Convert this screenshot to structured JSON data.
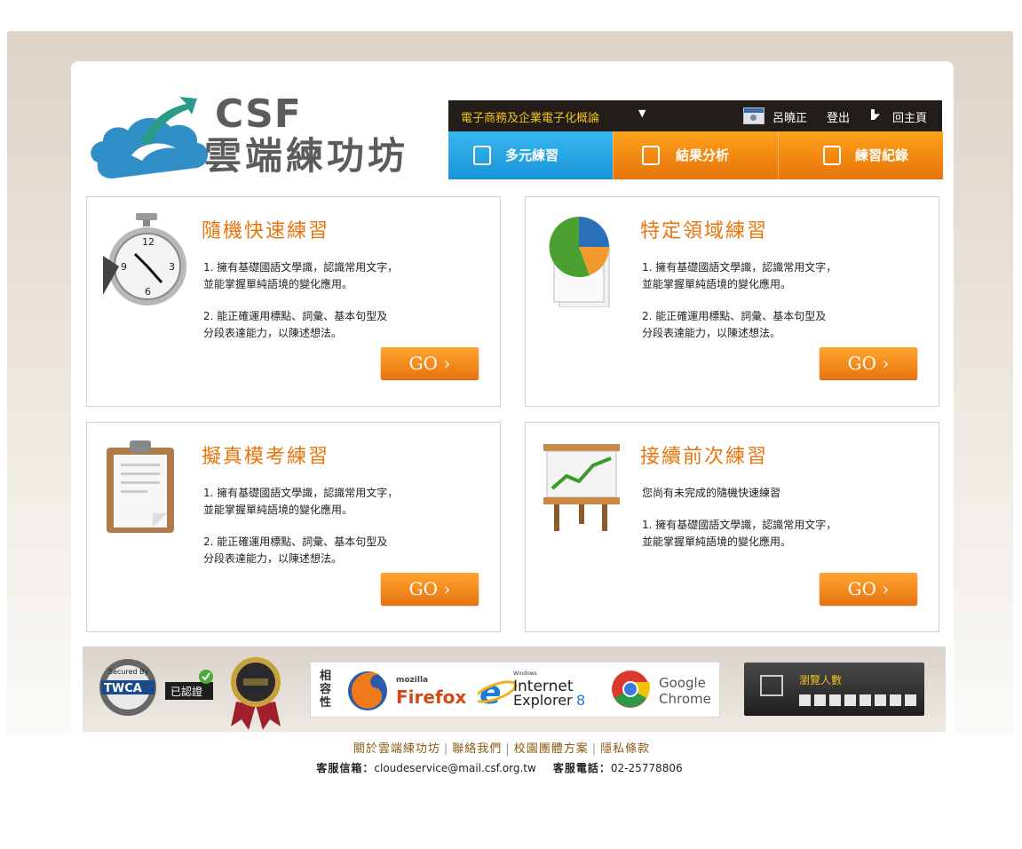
{
  "logo": {
    "brand": "CSF",
    "name": "雲端練功坊"
  },
  "topbar": {
    "course": "電子商務及企業電子化概論",
    "user": "呂曉正",
    "logout": "登出",
    "home": "回主頁"
  },
  "nav": [
    {
      "label": "多元練習",
      "icon": "calendar-clock-icon"
    },
    {
      "label": "結果分析",
      "icon": "document-icon"
    },
    {
      "label": "練習紀錄",
      "icon": "pencil-note-icon"
    }
  ],
  "panels": [
    {
      "title": "隨機快速練習",
      "desc1": "1. 擁有基礎國語文學識，認識常用文字，\n並能掌握單純語境的變化應用。",
      "desc2": "2. 能正確運用標點、詞彙、基本句型及\n分段表達能力，以陳述想法。",
      "go": "GO ›",
      "icon": "stopwatch-icon"
    },
    {
      "title": "特定領域練習",
      "desc1": "1. 擁有基礎國語文學識，認識常用文字，\n並能掌握單純語境的變化應用。",
      "desc2": "2. 能正確運用標點、詞彙、基本句型及\n分段表達能力，以陳述想法。",
      "go": "GO ›",
      "icon": "pie-chart-document-icon"
    },
    {
      "title": "擬真模考練習",
      "desc1": "1. 擁有基礎國語文學識，認識常用文字，\n並能掌握單純語境的變化應用。",
      "desc2": "2. 能正確運用標點、詞彙、基本句型及\n分段表達能力，以陳述想法。",
      "go": "GO ›",
      "icon": "clipboard-icon"
    },
    {
      "title": "接續前次練習",
      "desc1": "您尚有未完成的隨機快速練習",
      "desc2": "1. 擁有基礎國語文學識，認識常用文字，\n並能掌握單純語境的變化應用。",
      "go": "GO ›",
      "icon": "presentation-board-icon"
    }
  ],
  "badges": {
    "twca": "TWCA",
    "twca_top": "Secured By",
    "twca_verified": "已認證"
  },
  "compat": {
    "label": "相容性",
    "firefox_small": "mozilla",
    "firefox": "Firefox",
    "ie_small": "Windows",
    "ie_line1": "Internet",
    "ie_line2": "Explorer",
    "ie_ver": "8",
    "chrome_line1": "Google",
    "chrome_line2": "Chrome"
  },
  "visitors": {
    "label": "瀏覽人數"
  },
  "footer": {
    "links": [
      "關於雲端練功坊",
      "聯絡我們",
      "校園團體方案",
      "隱私條款"
    ],
    "email_label": "客服信箱：",
    "email": "cloudeservice@mail.csf.org.tw",
    "phone_label": "客服電話：",
    "phone": "02-25778806"
  },
  "colors": {
    "accent": "#e8750c",
    "blue": "#1a94d8",
    "dark": "#221d19"
  }
}
